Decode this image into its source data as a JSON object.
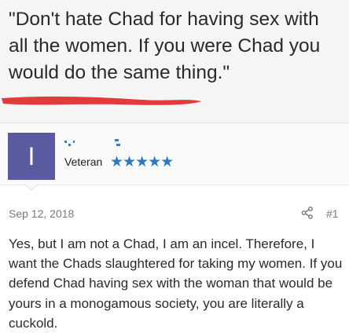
{
  "quote": {
    "text": "\"Don't hate Chad for having sex with all the women. If you were Chad you would do the same thing.\""
  },
  "user": {
    "avatar_letter": "I",
    "title": "Veteran",
    "stars": "★★★★★",
    "colors": {
      "avatar": "#5a5aa0",
      "stars": "#2e78c4",
      "redaction": "#e23b3b"
    }
  },
  "post": {
    "date": "Sep 12, 2018",
    "number": "#1",
    "body": "Yes, but I am not a Chad, I am an incel. Therefore, I want the Chads slaughtered for taking my women. If you defend Chad having sex with the woman that would be yours in a monogamous society, you are literally a cuckold."
  }
}
